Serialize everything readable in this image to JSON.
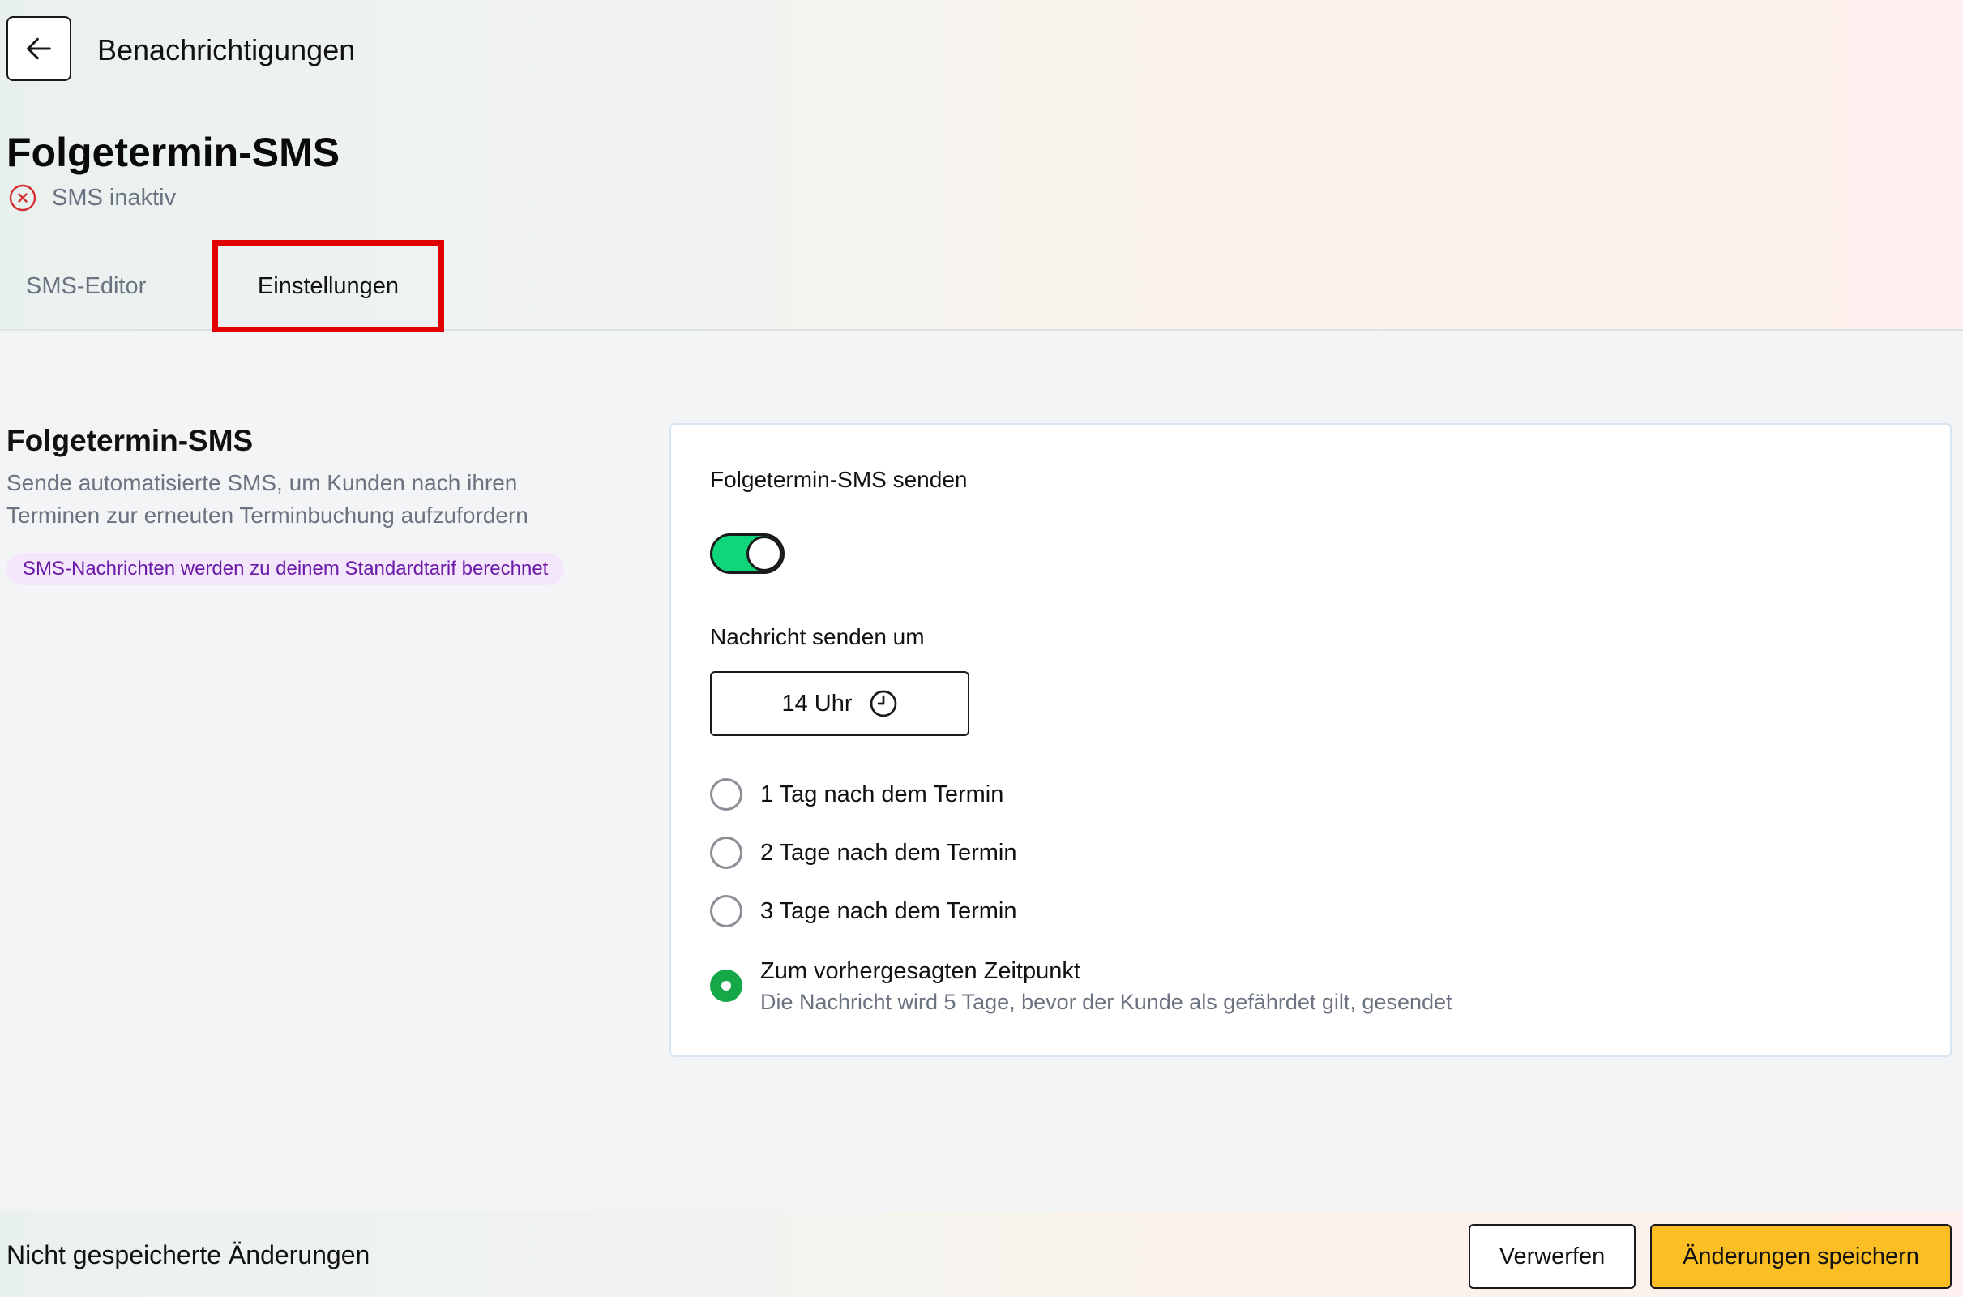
{
  "header": {
    "back_icon": "arrow-left-icon",
    "breadcrumb": "Benachrichtigungen",
    "title": "Folgetermin-SMS",
    "status": {
      "icon": "x-circle-icon",
      "text": "SMS inaktiv",
      "color": "#d32f2f"
    }
  },
  "tabs": [
    {
      "label": "SMS-Editor",
      "active": false
    },
    {
      "label": "Einstellungen",
      "active": true
    }
  ],
  "sidebar": {
    "title": "Folgetermin-SMS",
    "description": "Sende automatisierte SMS, um Kunden nach ihren Terminen zur erneuten Terminbuchung aufzufordern",
    "badge": "SMS-Nachrichten werden zu deinem Standardtarif berechnet"
  },
  "settings": {
    "send_label": "Folgetermin-SMS senden",
    "send_enabled": true,
    "toggle_color": "#0fd67a",
    "time_label": "Nachricht senden um",
    "time_value": "14 Uhr",
    "time_icon": "clock-icon",
    "options": [
      {
        "label": "1 Tag nach dem Termin",
        "selected": false
      },
      {
        "label": "2 Tage nach dem Termin",
        "selected": false
      },
      {
        "label": "3 Tage nach dem Termin",
        "selected": false
      },
      {
        "label": "Zum vorhergesagten Zeitpunkt",
        "sublabel": "Die Nachricht wird 5 Tage, bevor der Kunde als gefährdet gilt, gesendet",
        "selected": true
      }
    ]
  },
  "footer": {
    "unsaved_text": "Nicht gespeicherte Änderungen",
    "discard_label": "Verwerfen",
    "save_label": "Änderungen speichern",
    "save_color": "#fbbf24"
  }
}
